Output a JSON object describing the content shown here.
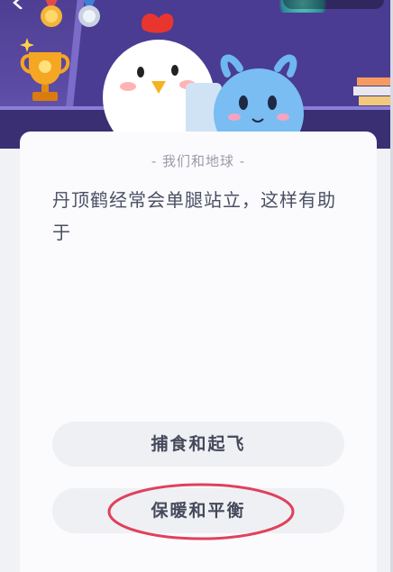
{
  "header": {
    "icons": [
      "back-icon",
      "gold-medal-icon",
      "silver-medal-icon",
      "trophy-icon",
      "bookmark-icon",
      "globe-icon",
      "more-icon"
    ],
    "colors": {
      "banner": "#5a4aa3",
      "card": "#fbfbfd",
      "option_bg": "#eef0f4",
      "highlight": "#e0415b"
    }
  },
  "quiz": {
    "subtitle": "- 我们和地球 -",
    "question": "丹顶鹤经常会单腿站立，这样有助于",
    "options": [
      {
        "label": "捕食和起飞"
      },
      {
        "label": "保暖和平衡"
      }
    ]
  }
}
